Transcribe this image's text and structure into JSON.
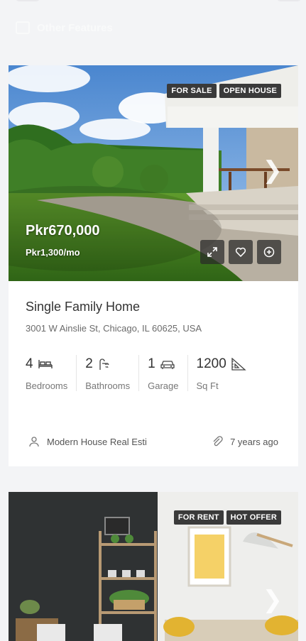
{
  "header": {
    "other_features": "Other Features"
  },
  "listings": [
    {
      "badges": [
        "FOR SALE",
        "OPEN HOUSE"
      ],
      "price": "Pkr670,000",
      "price_sub": "Pkr1,300/mo",
      "title": "Single Family Home",
      "address": "3001 W Ainslie St, Chicago, IL 60625, USA",
      "stats": [
        {
          "value": "4",
          "label": "Bedrooms",
          "icon": "bed-icon"
        },
        {
          "value": "2",
          "label": "Bathrooms",
          "icon": "shower-icon"
        },
        {
          "value": "1",
          "label": "Garage",
          "icon": "car-icon"
        },
        {
          "value": "1200",
          "label": "Sq Ft",
          "icon": "ruler-icon"
        }
      ],
      "agent": "Modern House Real Esti",
      "posted": "7 years ago"
    },
    {
      "badges": [
        "FOR RENT",
        "HOT OFFER"
      ]
    }
  ],
  "icons": [
    "expand-icon",
    "heart-icon",
    "plus-circle-icon",
    "user-icon",
    "paperclip-icon",
    "chevron-right-icon"
  ]
}
